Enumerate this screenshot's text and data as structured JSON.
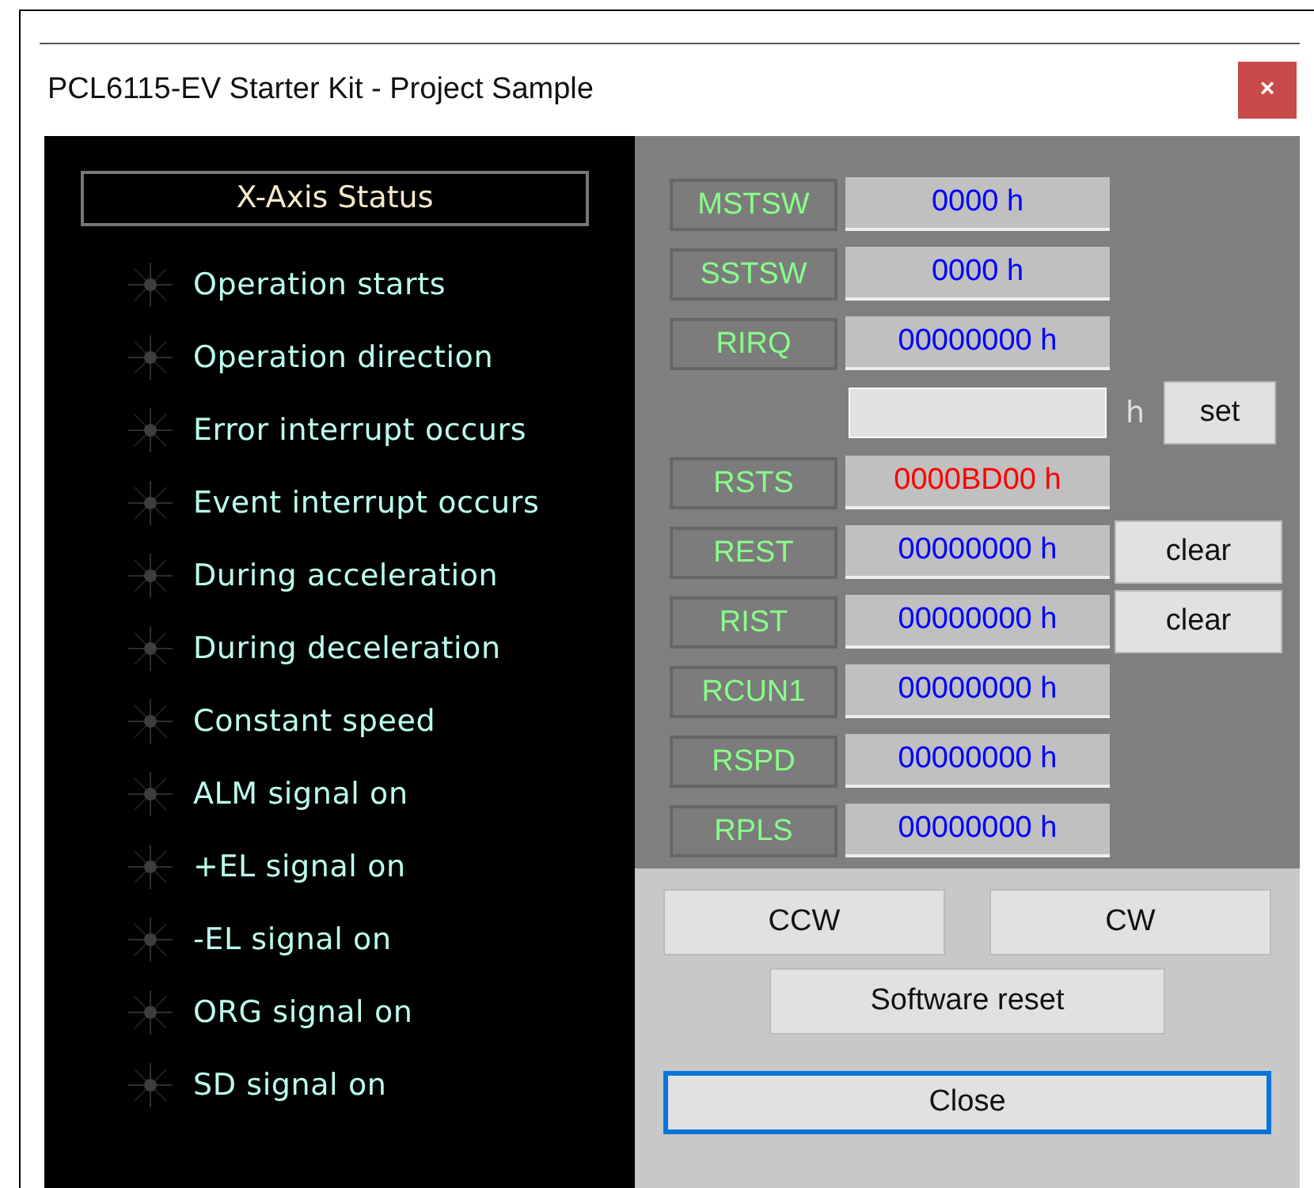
{
  "window": {
    "title": "PCL6115-EV Starter Kit - Project Sample",
    "close": "×"
  },
  "status_panel": {
    "title": "X-Axis  Status",
    "items": [
      {
        "label": "Operation starts",
        "on": false
      },
      {
        "label": "Operation direction",
        "on": false
      },
      {
        "label": "Error interrupt occurs",
        "on": false
      },
      {
        "label": "Event interrupt occurs",
        "on": false
      },
      {
        "label": "During acceleration",
        "on": false
      },
      {
        "label": "During deceleration",
        "on": false
      },
      {
        "label": "Constant speed",
        "on": false
      },
      {
        "label": "ALM signal on",
        "on": false
      },
      {
        "label": "+EL signal on",
        "on": false
      },
      {
        "label": "-EL signal on",
        "on": false
      },
      {
        "label": "ORG signal on",
        "on": false
      },
      {
        "label": "SD signal on",
        "on": false
      }
    ]
  },
  "registers": [
    {
      "kind": "register",
      "name": "MSTSW",
      "value": "0000 h",
      "color": "#0000ff"
    },
    {
      "kind": "register",
      "name": "SSTSW",
      "value": "0000 h",
      "color": "#0000ff"
    },
    {
      "kind": "register",
      "name": "RIRQ",
      "value": "00000000 h",
      "color": "#0000ff"
    },
    {
      "kind": "input",
      "unit": "h",
      "button": "set"
    },
    {
      "kind": "register",
      "name": "RSTS",
      "value": "0000BD00 h",
      "color": "#ff0000"
    },
    {
      "kind": "register",
      "name": "REST",
      "value": "00000000 h",
      "color": "#0000ff",
      "button": "clear"
    },
    {
      "kind": "register",
      "name": "RIST",
      "value": "00000000 h",
      "color": "#0000ff",
      "button": "clear"
    },
    {
      "kind": "register",
      "name": "RCUN1",
      "value": "00000000 h",
      "color": "#0000ff"
    },
    {
      "kind": "register",
      "name": "RSPD",
      "value": "00000000 h",
      "color": "#0000ff"
    },
    {
      "kind": "register",
      "name": "RPLS",
      "value": "00000000 h",
      "color": "#0000ff"
    }
  ],
  "buttons": {
    "ccw": "CCW",
    "cw": "CW",
    "reset": "Software reset",
    "close": {
      "label": "Close",
      "focused": true
    }
  }
}
